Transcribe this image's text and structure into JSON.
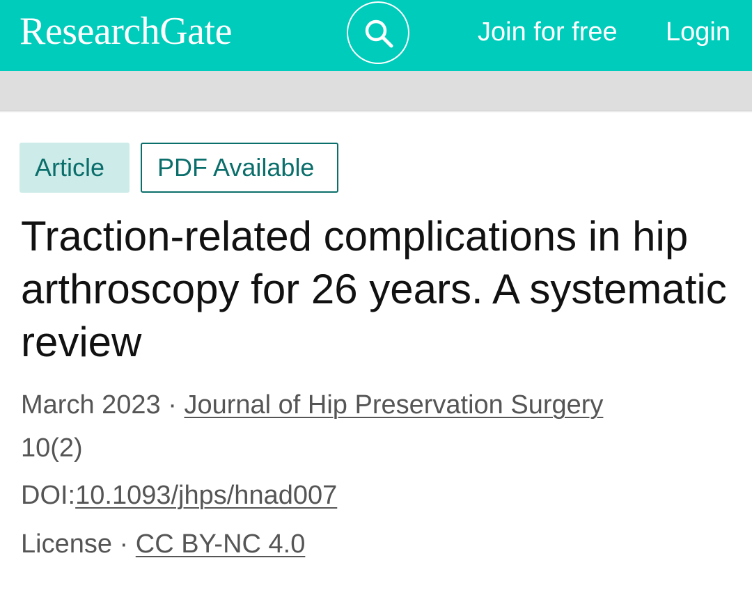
{
  "header": {
    "logo_text": "ResearchGate",
    "search_icon": "search-icon",
    "join_label": "Join for free",
    "login_label": "Login",
    "brand_color": "#00ccbb"
  },
  "badges": {
    "article": "Article",
    "pdf": "PDF Available"
  },
  "article": {
    "title": "Traction-related complications in hip arthroscopy for 26 years. A systematic review",
    "date": "March 2023",
    "separator": " · ",
    "journal": "Journal of Hip Preservation Surgery",
    "issue": "10(2)",
    "doi_label": "DOI:",
    "doi": "10.1093/jhps/hnad007",
    "license_label": "License",
    "license": "CC BY-NC 4.0"
  }
}
